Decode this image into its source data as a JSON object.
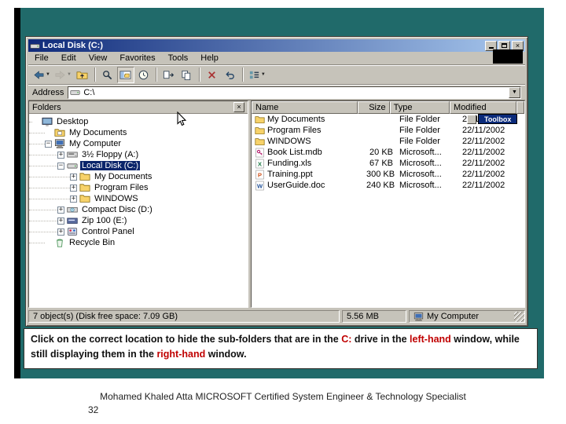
{
  "window": {
    "title": "Local Disk (C:)",
    "menu": [
      "File",
      "Edit",
      "View",
      "Favorites",
      "Tools",
      "Help"
    ],
    "toolbar": [
      {
        "icon": "back",
        "dropdown": true
      },
      {
        "icon": "forward",
        "dropdown": true,
        "disabled": true
      },
      {
        "icon": "up"
      },
      {
        "sep": true
      },
      {
        "icon": "search"
      },
      {
        "icon": "folders",
        "pressed": true
      },
      {
        "icon": "history"
      },
      {
        "sep": true
      },
      {
        "icon": "move-to"
      },
      {
        "icon": "copy-to"
      },
      {
        "sep": true
      },
      {
        "icon": "delete"
      },
      {
        "icon": "undo"
      },
      {
        "sep": true
      },
      {
        "icon": "views",
        "dropdown": true
      }
    ],
    "address_label": "Address",
    "address_value": "C:\\",
    "folders_header": "Folders",
    "tree": [
      {
        "label": "Desktop",
        "icon": "desktop",
        "indent": 0,
        "expander": "none"
      },
      {
        "label": "My Documents",
        "icon": "folder-docs",
        "indent": 1,
        "expander": "none"
      },
      {
        "label": "My Computer",
        "icon": "computer",
        "indent": 1,
        "expander": "minus"
      },
      {
        "label": "3½ Floppy (A:)",
        "icon": "floppy",
        "indent": 2,
        "expander": "plus"
      },
      {
        "label": "Local Disk (C:)",
        "icon": "disk",
        "indent": 2,
        "expander": "minus",
        "selected": true
      },
      {
        "label": "My Documents",
        "icon": "folder",
        "indent": 3,
        "expander": "plus"
      },
      {
        "label": "Program Files",
        "icon": "folder",
        "indent": 3,
        "expander": "plus"
      },
      {
        "label": "WINDOWS",
        "icon": "folder",
        "indent": 3,
        "expander": "plus"
      },
      {
        "label": "Compact Disc (D:)",
        "icon": "cd",
        "indent": 2,
        "expander": "plus"
      },
      {
        "label": "Zip 100 (E:)",
        "icon": "zip",
        "indent": 2,
        "expander": "plus"
      },
      {
        "label": "Control Panel",
        "icon": "control-panel",
        "indent": 2,
        "expander": "plus"
      },
      {
        "label": "Recycle Bin",
        "icon": "recycle-bin",
        "indent": 1,
        "expander": "none"
      }
    ],
    "file_list": {
      "columns": [
        "Name",
        "Size",
        "Type",
        "Modified"
      ],
      "rows": [
        {
          "name": "My Documents",
          "size": "",
          "type": "File Folder",
          "modified": "22/11/2002",
          "icon": "folder"
        },
        {
          "name": "Program Files",
          "size": "",
          "type": "File Folder",
          "modified": "22/11/2002",
          "icon": "folder"
        },
        {
          "name": "WINDOWS",
          "size": "",
          "type": "File Folder",
          "modified": "22/11/2002",
          "icon": "folder"
        },
        {
          "name": "Book List.mdb",
          "size": "20 KB",
          "type": "Microsoft...",
          "modified": "22/11/2002",
          "icon": "mdb"
        },
        {
          "name": "Funding.xls",
          "size": "67 KB",
          "type": "Microsoft...",
          "modified": "22/11/2002",
          "icon": "xls"
        },
        {
          "name": "Training.ppt",
          "size": "300 KB",
          "type": "Microsoft...",
          "modified": "22/11/2002",
          "icon": "ppt"
        },
        {
          "name": "UserGuide.doc",
          "size": "240 KB",
          "type": "Microsoft...",
          "modified": "22/11/2002",
          "icon": "doc"
        }
      ]
    },
    "toolbox_label": "Toolbox",
    "status": {
      "left": "7 object(s) (Disk free space: 7.09 GB)",
      "middle": "5.56 MB",
      "right": "My Computer"
    }
  },
  "instruction": {
    "segments": [
      {
        "text": "Click on the correct location to hide the sub-folders that are in the ",
        "color": "black"
      },
      {
        "text": "C:",
        "color": "red"
      },
      {
        "text": " drive in the ",
        "color": "black"
      },
      {
        "text": "left-hand",
        "color": "red"
      },
      {
        "text": " window, while still displaying them in the ",
        "color": "black"
      },
      {
        "text": "right-hand",
        "color": "red"
      },
      {
        "text": " window.",
        "color": "black"
      }
    ]
  },
  "footer": {
    "credit": "Mohamed Khaled Atta MICROSOFT Certified System Engineer & Technology Specialist",
    "page_number": "32"
  }
}
